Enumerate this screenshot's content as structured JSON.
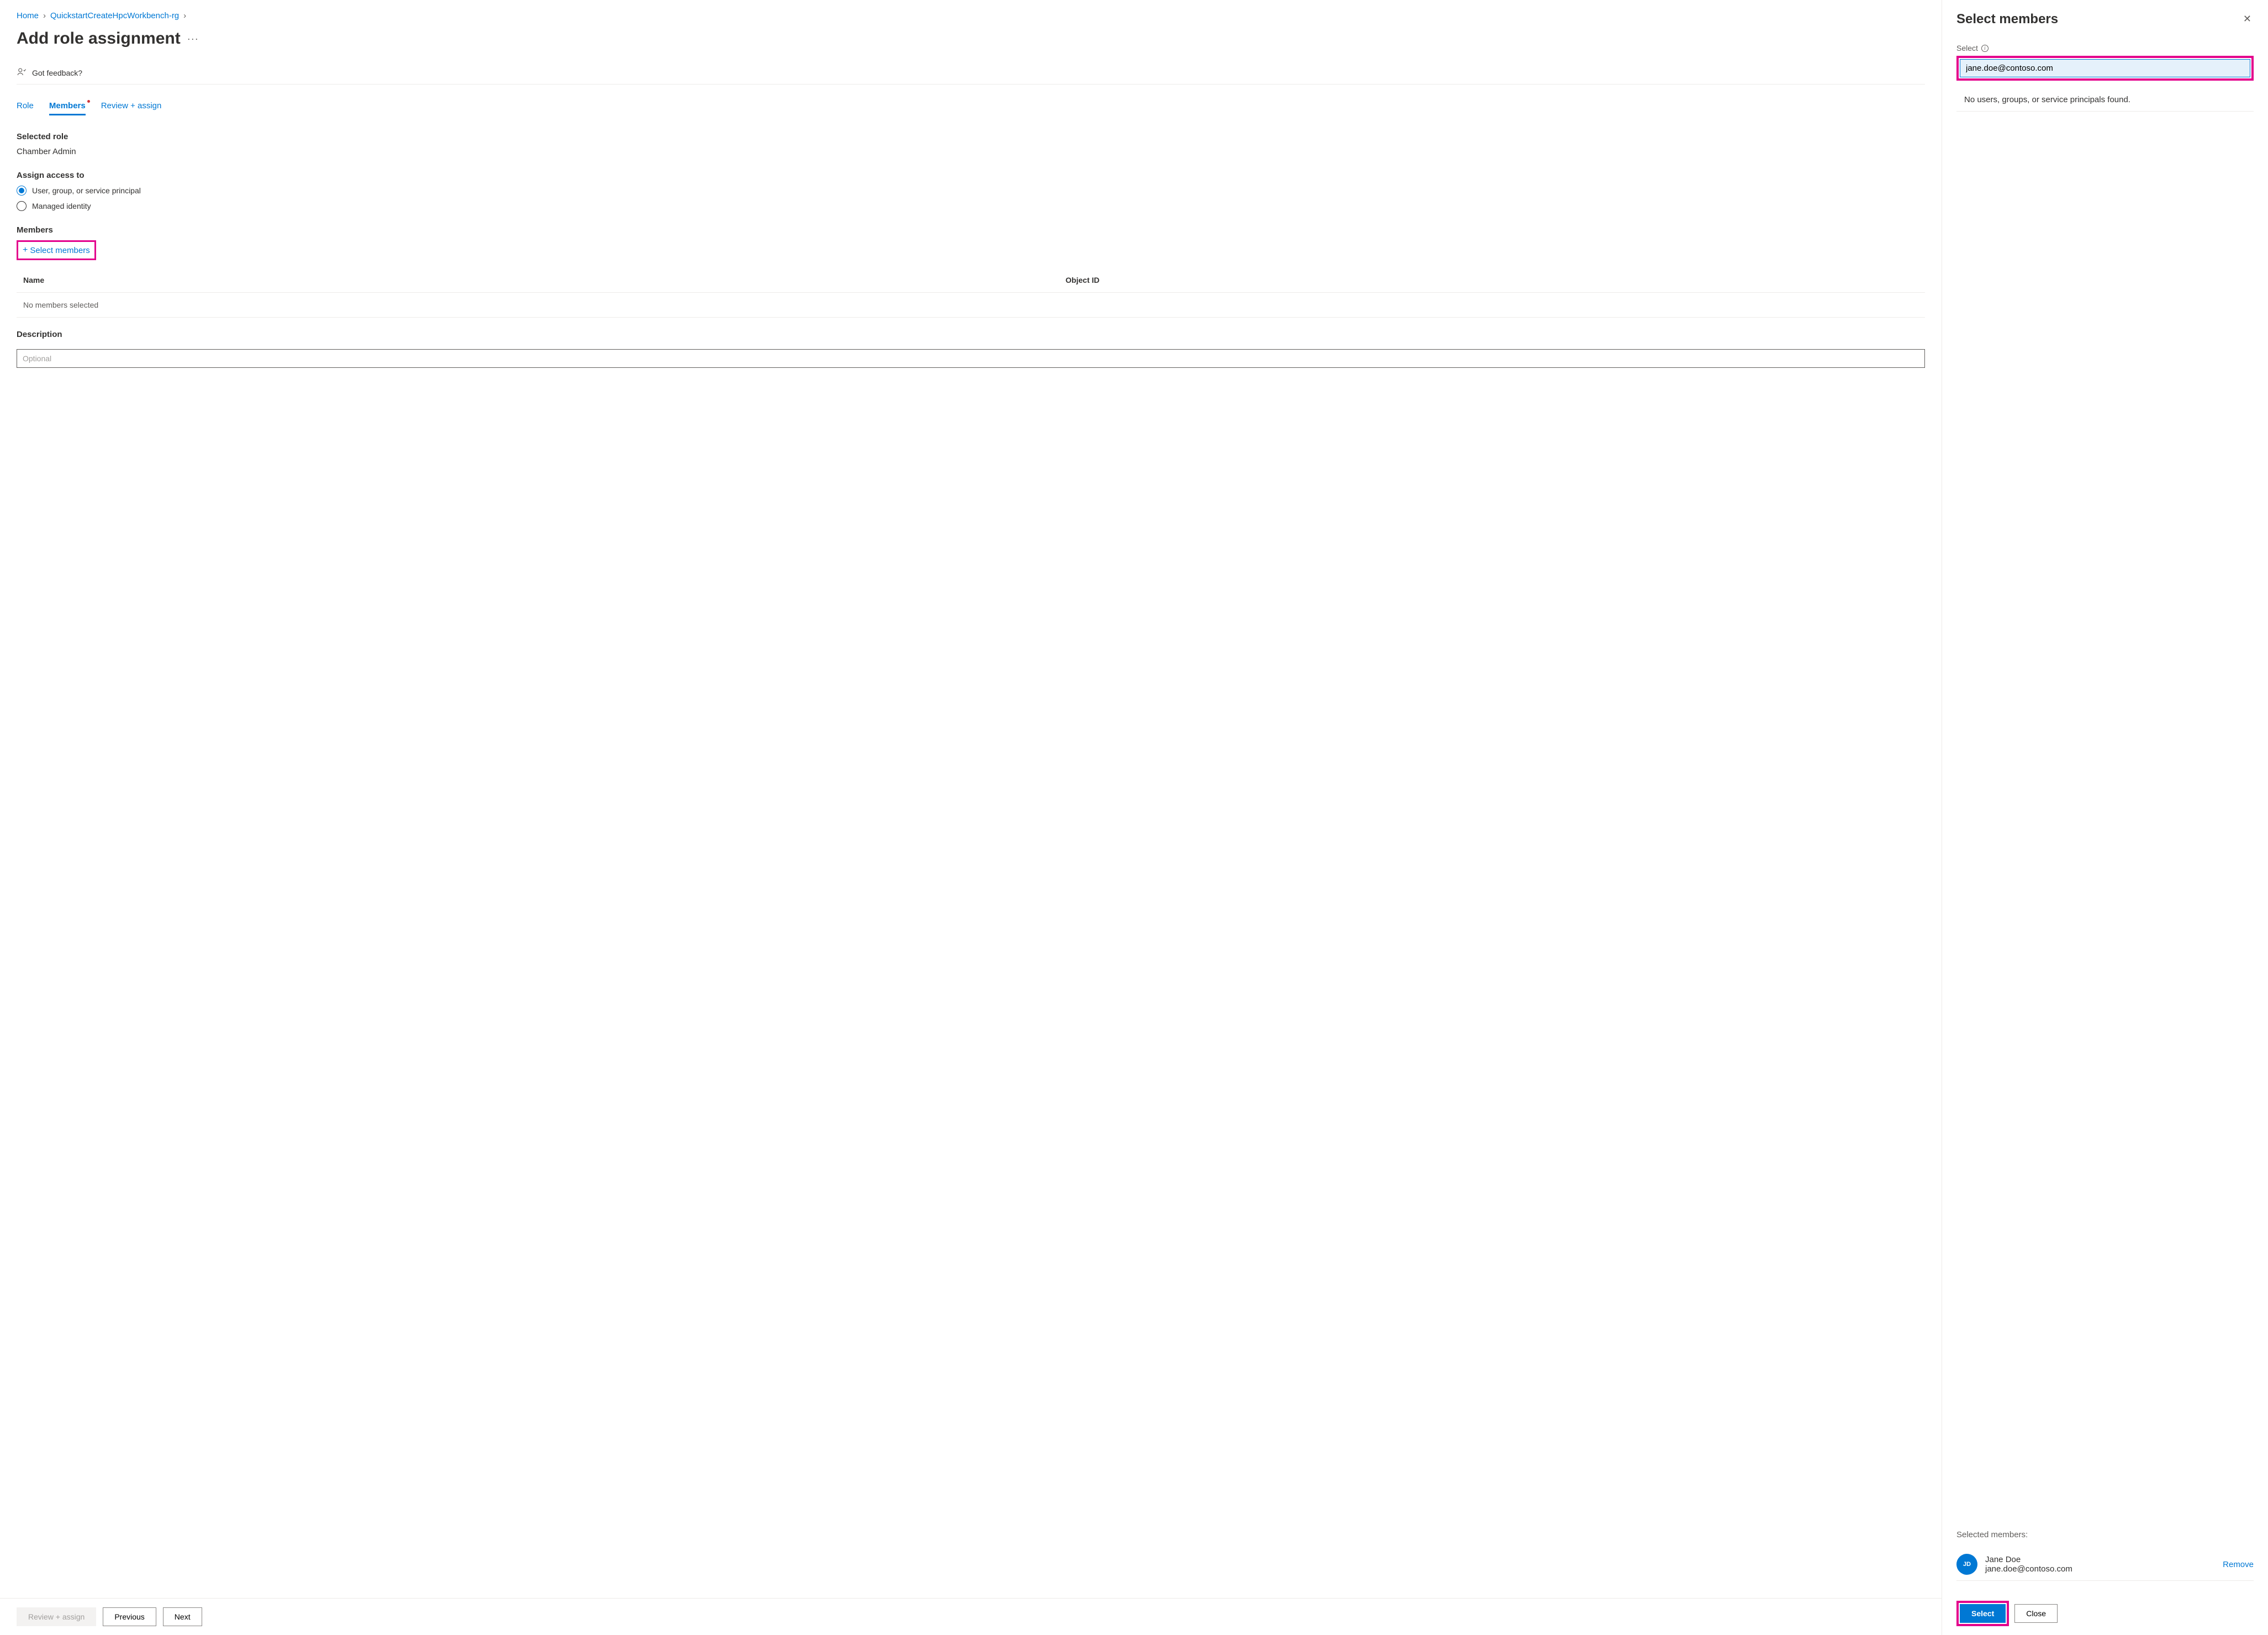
{
  "breadcrumb": {
    "home": "Home",
    "resource": "QuickstartCreateHpcWorkbench-rg"
  },
  "page_title": "Add role assignment",
  "feedback_label": "Got feedback?",
  "tabs": {
    "role": "Role",
    "members": "Members",
    "review": "Review + assign"
  },
  "selected_role": {
    "label": "Selected role",
    "value": "Chamber Admin"
  },
  "assign_access": {
    "label": "Assign access to",
    "option_user": "User, group, or service principal",
    "option_managed": "Managed identity"
  },
  "members": {
    "label": "Members",
    "select_link": "Select members",
    "col_name": "Name",
    "col_id": "Object ID",
    "empty": "No members selected"
  },
  "description": {
    "label": "Description",
    "placeholder": "Optional"
  },
  "footer": {
    "review": "Review + assign",
    "previous": "Previous",
    "next": "Next"
  },
  "panel": {
    "title": "Select members",
    "select_label": "Select",
    "search_value": "jane.doe@contoso.com",
    "no_results": "No users, groups, or service principals found.",
    "selected_label": "Selected members:",
    "member": {
      "initials": "JD",
      "name": "Jane Doe",
      "email": "jane.doe@contoso.com"
    },
    "remove": "Remove",
    "select_btn": "Select",
    "close_btn": "Close"
  }
}
